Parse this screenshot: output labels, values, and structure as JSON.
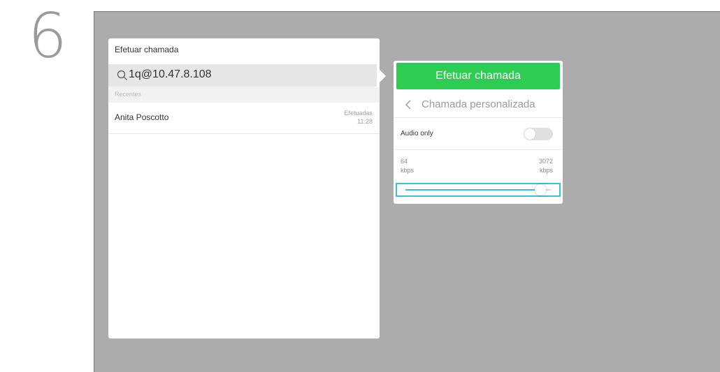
{
  "step": {
    "number": "6"
  },
  "left_panel": {
    "title": "Efetuar chamada",
    "search": {
      "value": "1q@10.47.8.108",
      "icon": "search-icon"
    },
    "recent_header": "Recentes",
    "contacts": [
      {
        "name": "Anita Poscotto",
        "type": "Efetuadas",
        "time": "11:28"
      }
    ]
  },
  "right_panel": {
    "call_button": "Efetuar chamada",
    "custom_call": "Chamada personalizada",
    "audio_only": {
      "label": "Audio only",
      "enabled": false
    },
    "rate": {
      "min_value": "64",
      "min_unit": "kbps",
      "max_value": "3072",
      "max_unit": "kbps",
      "slider_fraction": 0.93
    }
  },
  "colors": {
    "screen_bg": "#acacac",
    "call_button": "#2ecc52",
    "slider_accent": "#38c0dd"
  }
}
